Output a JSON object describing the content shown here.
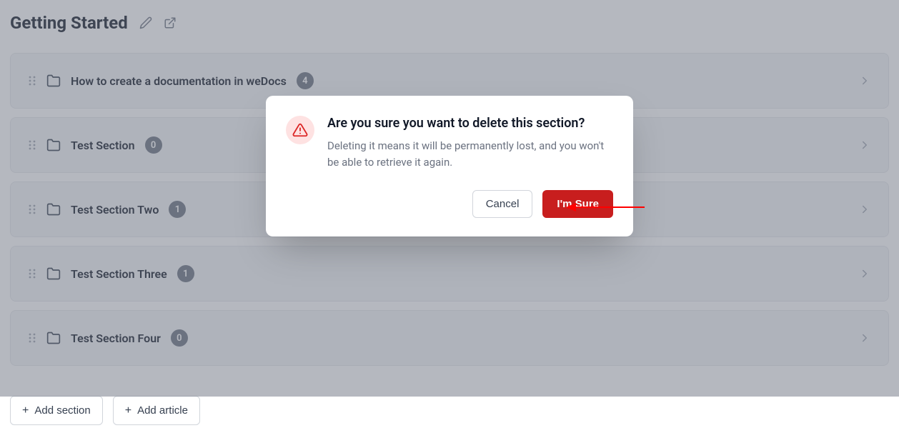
{
  "page": {
    "title": "Getting Started"
  },
  "sections": [
    {
      "name": "How to create a documentation in weDocs",
      "count": "4"
    },
    {
      "name": "Test Section",
      "count": "0"
    },
    {
      "name": "Test Section Two",
      "count": "1"
    },
    {
      "name": "Test Section Three",
      "count": "1"
    },
    {
      "name": "Test Section Four",
      "count": "0"
    }
  ],
  "buttons": {
    "add_section": "Add section",
    "add_article": "Add article"
  },
  "modal": {
    "title": "Are you sure you want to delete this section?",
    "description": "Deleting it means it will be permanently lost, and you won't be able to retrieve it again.",
    "cancel": "Cancel",
    "confirm": "I'm Sure"
  },
  "colors": {
    "danger": "#c81e1e",
    "danger_light": "#fee2e2",
    "badge_bg": "#6b7280"
  }
}
